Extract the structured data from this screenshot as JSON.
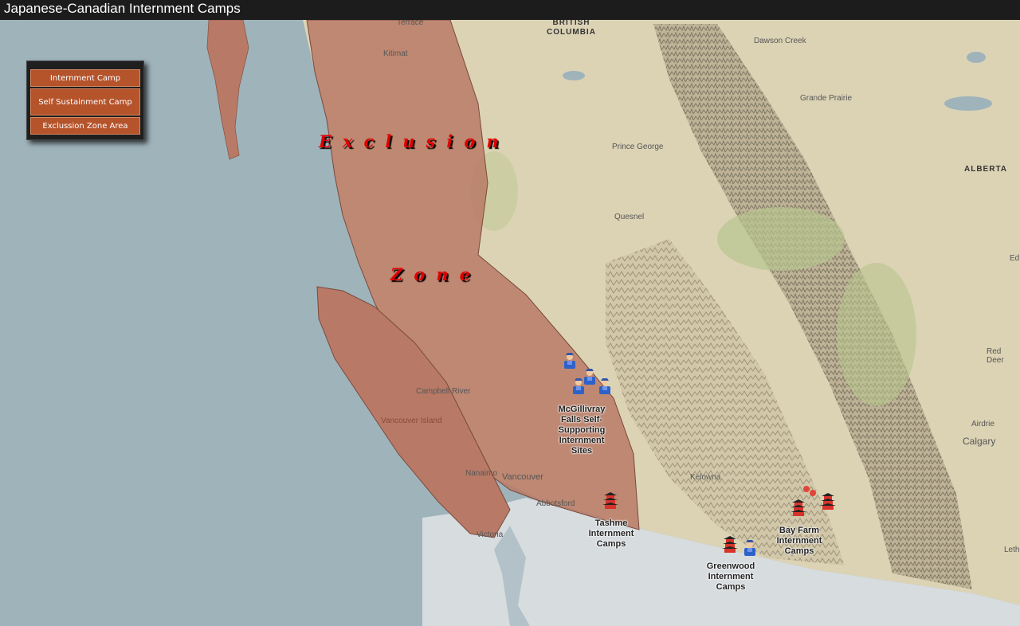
{
  "title": "Japanese-Canadian Internment Camps",
  "legend": {
    "items": [
      "Internment Camp",
      "Self Sustainment Camp",
      "Exclussion Zone Area"
    ]
  },
  "zone_label": {
    "line1": "Exclusion",
    "line2": "Zone"
  },
  "places": {
    "british_columbia": "BRITISH COLUMBIA",
    "alberta": "ALBERTA",
    "terrace": "Terrace",
    "kitimat": "Kitimat",
    "dawson_creek": "Dawson Creek",
    "grande_prairie": "Grande Prairie",
    "prince_george": "Prince George",
    "quesnel": "Quesnel",
    "red_deer": "Red Deer",
    "edmonton": "Ed",
    "campbell_river": "Campbell River",
    "vancouver_island": "Vancouver Island",
    "nanaimo": "Nanaimo",
    "vancouver": "Vancouver",
    "abbotsford": "Abbotsford",
    "victoria": "Victoria",
    "kelowna": "Kelowna",
    "airdrie": "Airdrie",
    "calgary": "Calgary",
    "lethbridge": "Leth"
  },
  "camps": {
    "mcgillivray": "McGillivray Falls Self-Supporting Internment Sites",
    "tashme": "Tashme Internment Camps",
    "bay_farm": "Bay Farm Internment Camps",
    "greenwood": "Greenwood Internment Camps"
  },
  "colors": {
    "ocean": "#9fb3bb",
    "land": "#dcd3b5",
    "exclusion_zone": "#b87a66",
    "legend_button": "#b5532b",
    "us_land": "#d7dcdf"
  },
  "icons": {
    "internment_camp": "red-pagoda-icon",
    "self_sustainment_camp": "worker-icon"
  }
}
